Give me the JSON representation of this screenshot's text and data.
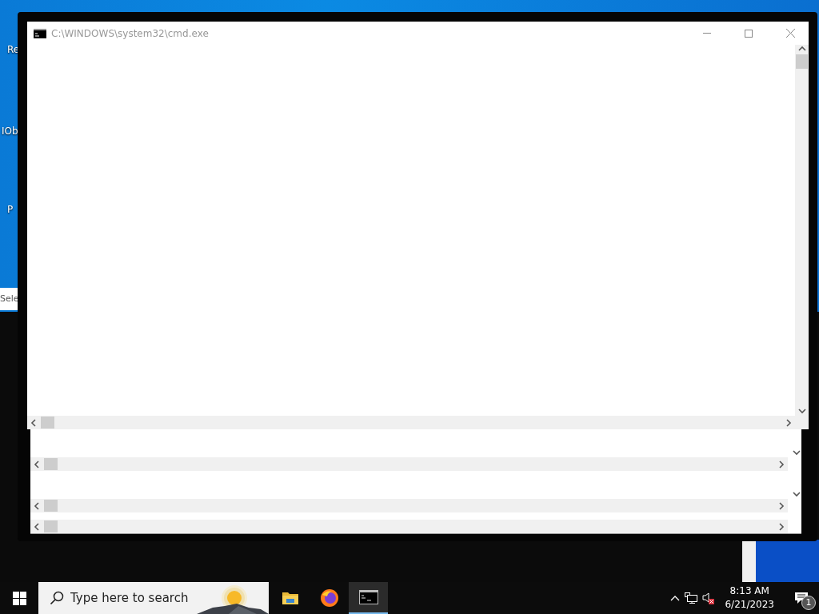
{
  "desktop": {
    "icon_labels": [
      "Re",
      "IOb",
      "P"
    ],
    "panel_text": "Sele"
  },
  "window": {
    "title": "C:\\WINDOWS\\system32\\cmd.exe"
  },
  "taskbar": {
    "search": {
      "placeholder": "Type here to search"
    },
    "apps": [
      {
        "kind": "folder",
        "selected": false
      },
      {
        "kind": "browser",
        "selected": false
      },
      {
        "kind": "terminal",
        "selected": true
      }
    ],
    "clock": {
      "time": "8:13 AM",
      "date": "6/21/2023"
    },
    "notifications": {
      "count": "1"
    }
  }
}
